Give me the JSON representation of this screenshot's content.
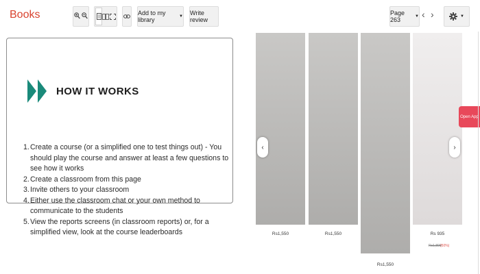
{
  "app": {
    "title": "Books"
  },
  "toolbar": {
    "zoom_in_icon": "zoom-in-icon",
    "zoom_out_icon": "zoom-out-icon",
    "add_library_label": "Add to my library",
    "write_review_label": "Write review",
    "page_label": "Page 263",
    "brand_color": "#d9432f"
  },
  "how": {
    "title": "HOW IT WORKS",
    "accent_color": "#1a8a7a",
    "steps": [
      {
        "num": "1.",
        "text": "Create a course (or a simplified one to test things out) - You should play the course and answer at least a few questions to see how it works"
      },
      {
        "num": "2.",
        "text": "Create a classroom from this page"
      },
      {
        "num": "3.",
        "text": "Invite others to your classroom"
      },
      {
        "num": "4.",
        "text": "Either use the classroom chat or your own method to communicate to the students"
      },
      {
        "num": "5.",
        "text": "View the reports screens (in classroom reports) or, for a simplified view, look at the course leaderboards"
      }
    ]
  },
  "products": [
    {
      "price": "Rs1,550",
      "shirt": "#8fa7c9",
      "check": "#3d5d94",
      "pants": "#5a7bb0"
    },
    {
      "price": "Rs1,550",
      "shirt": "#2a2a2a",
      "check": "#d8d8d8",
      "pants": "#4f6fa0"
    },
    {
      "price": "Rs1,550",
      "shirt": "#7fc8b4",
      "check": "#2a7a68",
      "pants": "#1e2a3a"
    },
    {
      "price": "Rs 935",
      "strike": "Rs1,899",
      "off": "(50%)",
      "shirt": "#b985a3",
      "check": "#a06d8a",
      "pants": "#9a6f88"
    }
  ],
  "open_app_label": "Open App"
}
